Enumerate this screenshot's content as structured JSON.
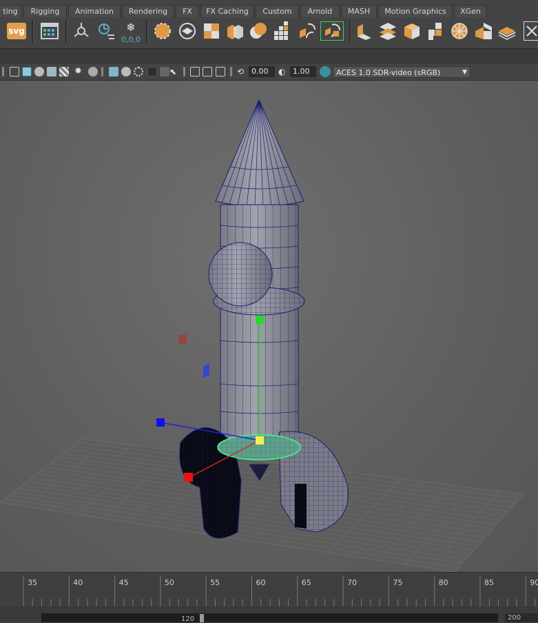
{
  "shelf": {
    "tabs": [
      "ting",
      "Rigging",
      "Animation",
      "Rendering",
      "FX",
      "FX Caching",
      "Custom",
      "Arnold",
      "MASH",
      "Motion Graphics",
      "XGen"
    ],
    "svg_label": "svg",
    "snap_label": "0,0,0",
    "icons": [
      "svg-tool-icon",
      "uv-editor-icon",
      "sweep-mesh-icon",
      "pivot-reset-icon",
      "freeze-transform-icon",
      "sphere-select-icon",
      "soft-select-icon",
      "combine-icon",
      "separate-icon",
      "boolean-icon",
      "multi-cut-icon",
      "extrude-icon",
      "bevel-icon",
      "bridge-icon",
      "smooth-icon",
      "mirror-icon",
      "quad-draw-icon",
      "target-weld-icon",
      "crease-icon",
      "mesh-display-icon"
    ]
  },
  "panel_toolbar": {
    "exposure_value": "0.00",
    "gamma_value": "1.00",
    "color_space": "ACES 1.0 SDR-video (sRGB)"
  },
  "timeline": {
    "ticks": [
      "35",
      "40",
      "45",
      "50",
      "55",
      "60",
      "65",
      "70",
      "75",
      "80",
      "85",
      "90"
    ],
    "range_current": "120",
    "range_end": "200"
  },
  "colors": {
    "accent_orange": "#e0a050",
    "accent_teal": "#3d8fa0",
    "wire": "#1a1f6e",
    "selection_green": "#3cff8a"
  }
}
